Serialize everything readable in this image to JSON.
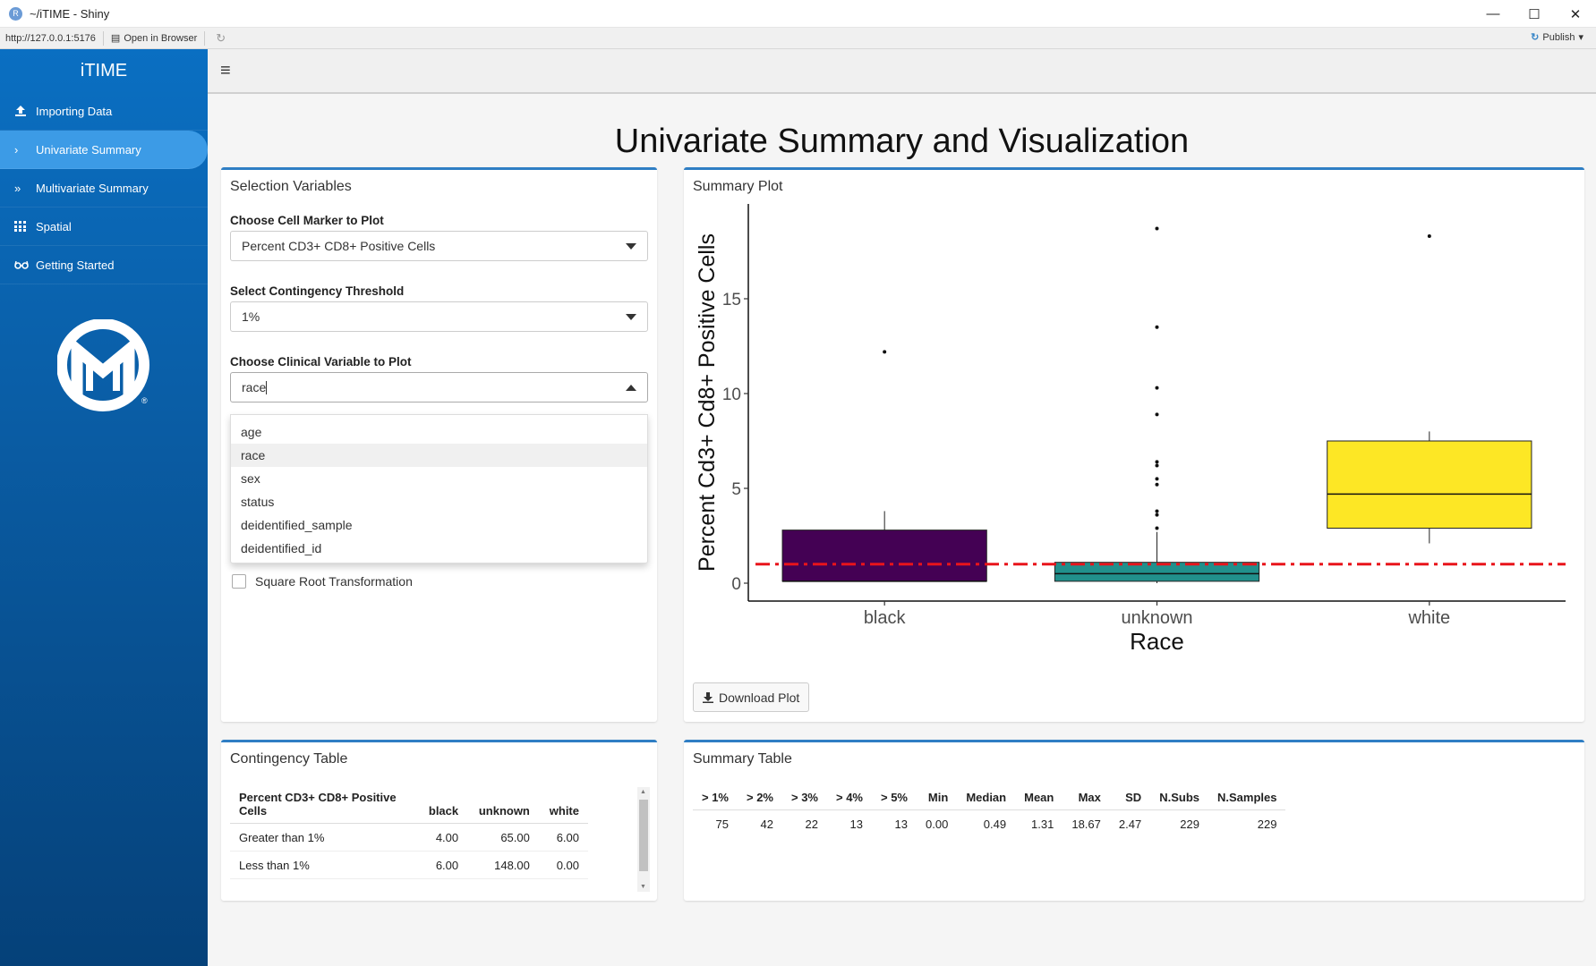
{
  "window": {
    "title": "~/iTIME - Shiny",
    "app_icon": "R"
  },
  "addressbar": {
    "url": "http://127.0.0.1:5176",
    "open_browser": "Open in Browser",
    "publish": "Publish"
  },
  "sidebar": {
    "brand": "iTIME",
    "items": [
      {
        "label": "Importing Data",
        "icon": "upload-icon"
      },
      {
        "label": "Univariate Summary",
        "icon": "chevron-right-icon"
      },
      {
        "label": "Multivariate Summary",
        "icon": "double-chevron-right-icon"
      },
      {
        "label": "Spatial",
        "icon": "grid-icon"
      },
      {
        "label": "Getting Started",
        "icon": "glasses-icon"
      }
    ],
    "active_index": 1,
    "logo_mark": "®"
  },
  "page": {
    "title": "Univariate Summary and Visualization"
  },
  "selection": {
    "title": "Selection Variables",
    "marker_label": "Choose Cell Marker to Plot",
    "marker_value": "Percent CD3+ CD8+ Positive Cells",
    "threshold_label": "Select Contingency Threshold",
    "threshold_value": "1%",
    "clinical_label": "Choose Clinical Variable to Plot",
    "clinical_value": "race",
    "clinical_options": [
      "age",
      "race",
      "sex",
      "status",
      "deidentified_sample",
      "deidentified_id"
    ],
    "highlighted_option": "race",
    "sqrt_label": "Square Root Transformation",
    "sqrt_checked": false
  },
  "plot": {
    "title": "Summary Plot",
    "download_label": "Download Plot"
  },
  "chart_data": {
    "type": "box",
    "categories": [
      "black",
      "unknown",
      "white"
    ],
    "xlabel": "Race",
    "ylabel": "Percent Cd3+ Cd8+ Positive Cells",
    "yticks": [
      "0",
      "5",
      "10",
      "15"
    ],
    "ylim": [
      0,
      20
    ],
    "colors": [
      "#440154",
      "#21908c",
      "#fde725"
    ],
    "boxes": [
      {
        "category": "black",
        "q1": 0.1,
        "median": 0.1,
        "q3": 2.8,
        "whisker_low": 0.1,
        "whisker_high": 3.8,
        "outliers": [
          12.2
        ]
      },
      {
        "category": "unknown",
        "q1": 0.1,
        "median": 0.5,
        "q3": 1.1,
        "whisker_low": 0.0,
        "whisker_high": 2.7,
        "outliers": [
          2.9,
          3.6,
          3.8,
          5.2,
          5.5,
          6.2,
          6.4,
          8.9,
          10.3,
          13.5,
          18.7
        ]
      },
      {
        "category": "white",
        "q1": 2.9,
        "median": 4.7,
        "q3": 7.5,
        "whisker_low": 2.1,
        "whisker_high": 8.0,
        "outliers": [
          18.3
        ]
      }
    ],
    "reference_line": {
      "y": 1,
      "color": "#e8141b",
      "style": "dash-dot"
    },
    "grid": false
  },
  "contingency": {
    "title": "Contingency Table",
    "headers": [
      "Percent CD3+ CD8+ Positive Cells",
      "black",
      "unknown",
      "white"
    ],
    "rows": [
      [
        "Greater than 1%",
        "4.00",
        "65.00",
        "6.00"
      ],
      [
        "Less than 1%",
        "6.00",
        "148.00",
        "0.00"
      ]
    ]
  },
  "summary": {
    "title": "Summary Table",
    "headers": [
      "> 1%",
      "> 2%",
      "> 3%",
      "> 4%",
      "> 5%",
      "Min",
      "Median",
      "Mean",
      "Max",
      "SD",
      "N.Subs",
      "N.Samples"
    ],
    "row": [
      "75",
      "42",
      "22",
      "13",
      "13",
      "0.00",
      "0.49",
      "1.31",
      "18.67",
      "2.47",
      "229",
      "229"
    ]
  }
}
